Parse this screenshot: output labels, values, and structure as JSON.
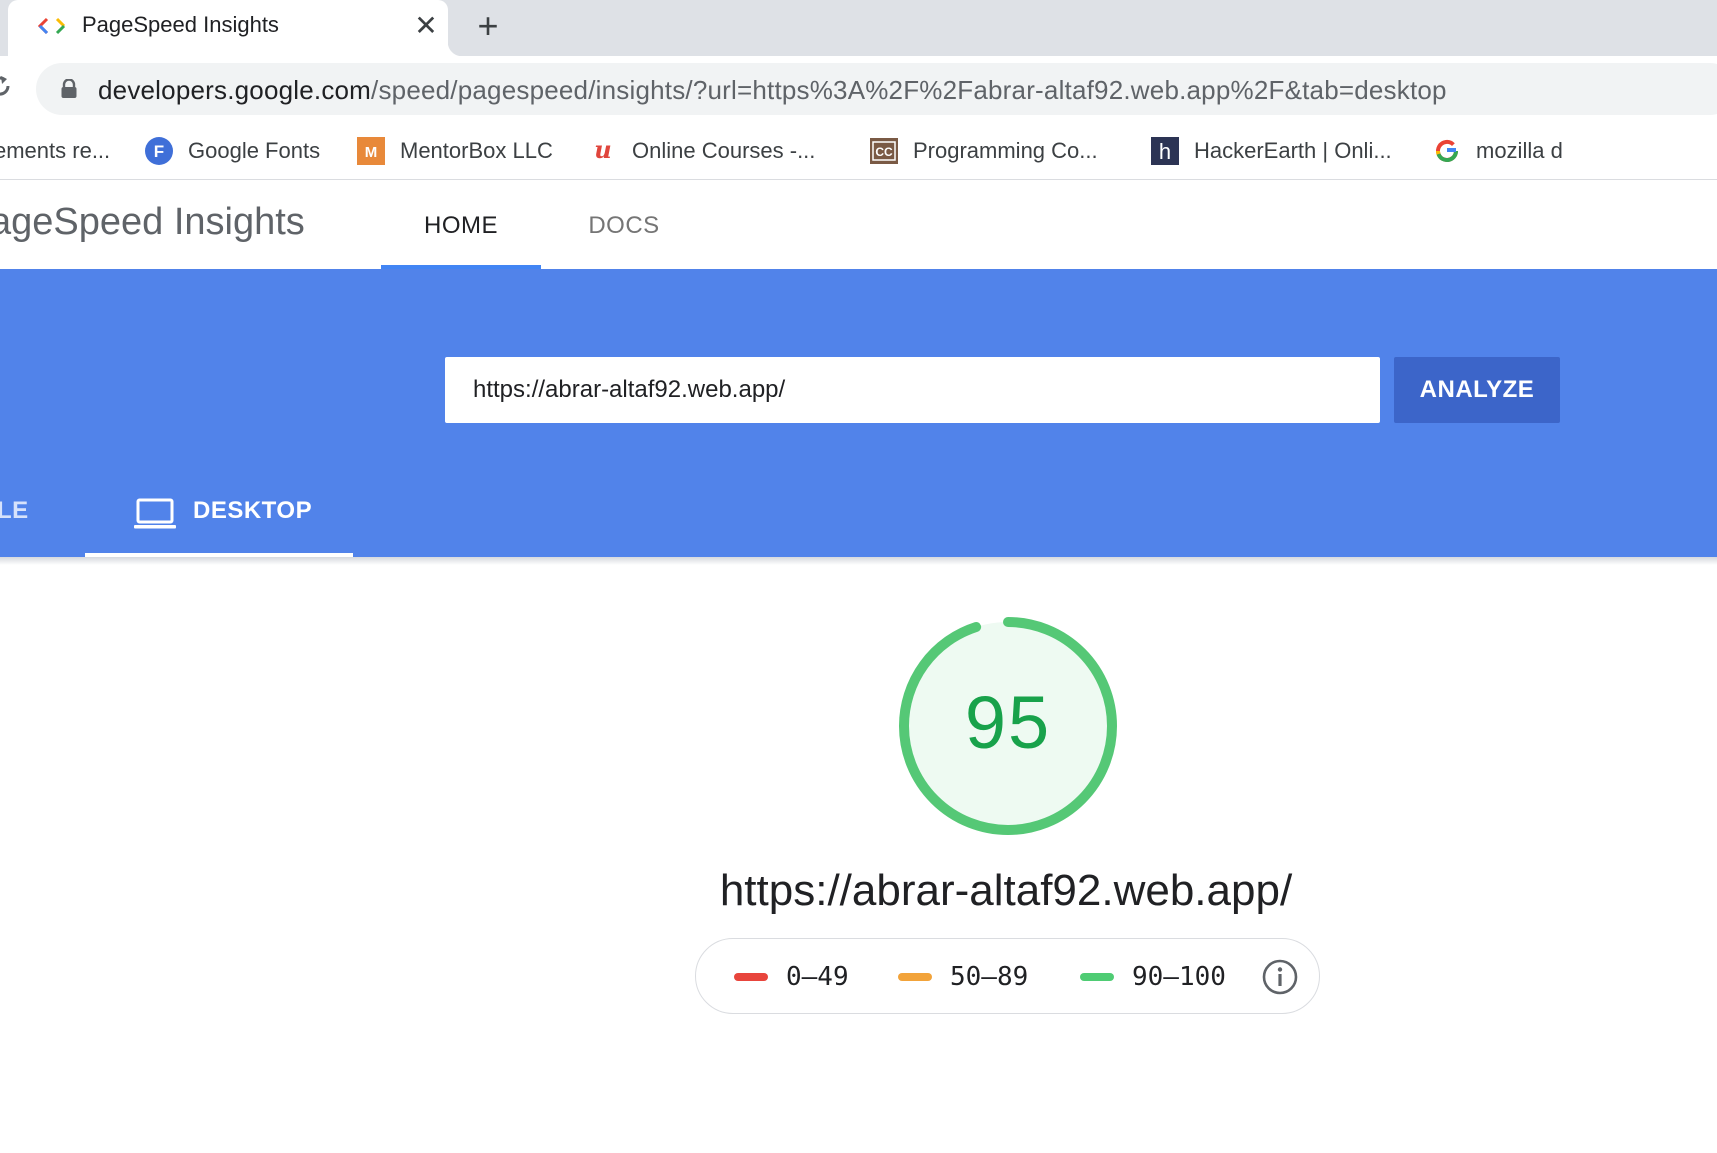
{
  "browser": {
    "tab_title": "PageSpeed Insights",
    "close_glyph": "✕",
    "new_tab_glyph": "+",
    "url_host": "developers.google.com",
    "url_path": "/speed/pagespeed/insights/?url=https%3A%2F%2Fabrar-altaf92.web.app%2F&tab=desktop"
  },
  "bookmarks": [
    {
      "label": "ements re...",
      "icon": "none"
    },
    {
      "label": "Google Fonts",
      "icon": "google-fonts-icon"
    },
    {
      "label": "MentorBox LLC",
      "icon": "mentorbox-icon"
    },
    {
      "label": "Online Courses -...",
      "icon": "udemy-icon"
    },
    {
      "label": "Programming Co...",
      "icon": "cc-icon"
    },
    {
      "label": "HackerEarth | Onli...",
      "icon": "hackerearth-icon"
    },
    {
      "label": "mozilla d",
      "icon": "google-icon"
    }
  ],
  "header": {
    "title": "ageSpeed Insights",
    "nav_home": "HOME",
    "nav_docs": "DOCS"
  },
  "search": {
    "value": "https://abrar-altaf92.web.app/",
    "analyze_label": "ANALYZE"
  },
  "device_tabs": {
    "mobile": "BILE",
    "desktop": "DESKTOP"
  },
  "result": {
    "score": "95",
    "score_fraction": 0.95,
    "url": "https://abrar-altaf92.web.app/"
  },
  "legend": [
    {
      "label": "0–49",
      "color": "#e8453c"
    },
    {
      "label": "50–89",
      "color": "#f2a33a"
    },
    {
      "label": "90–100",
      "color": "#4fcc74"
    }
  ],
  "colors": {
    "hero": "#5183ea",
    "analyze": "#3c65c9",
    "score_ring": "#55c876",
    "score_text": "#18a24b"
  }
}
